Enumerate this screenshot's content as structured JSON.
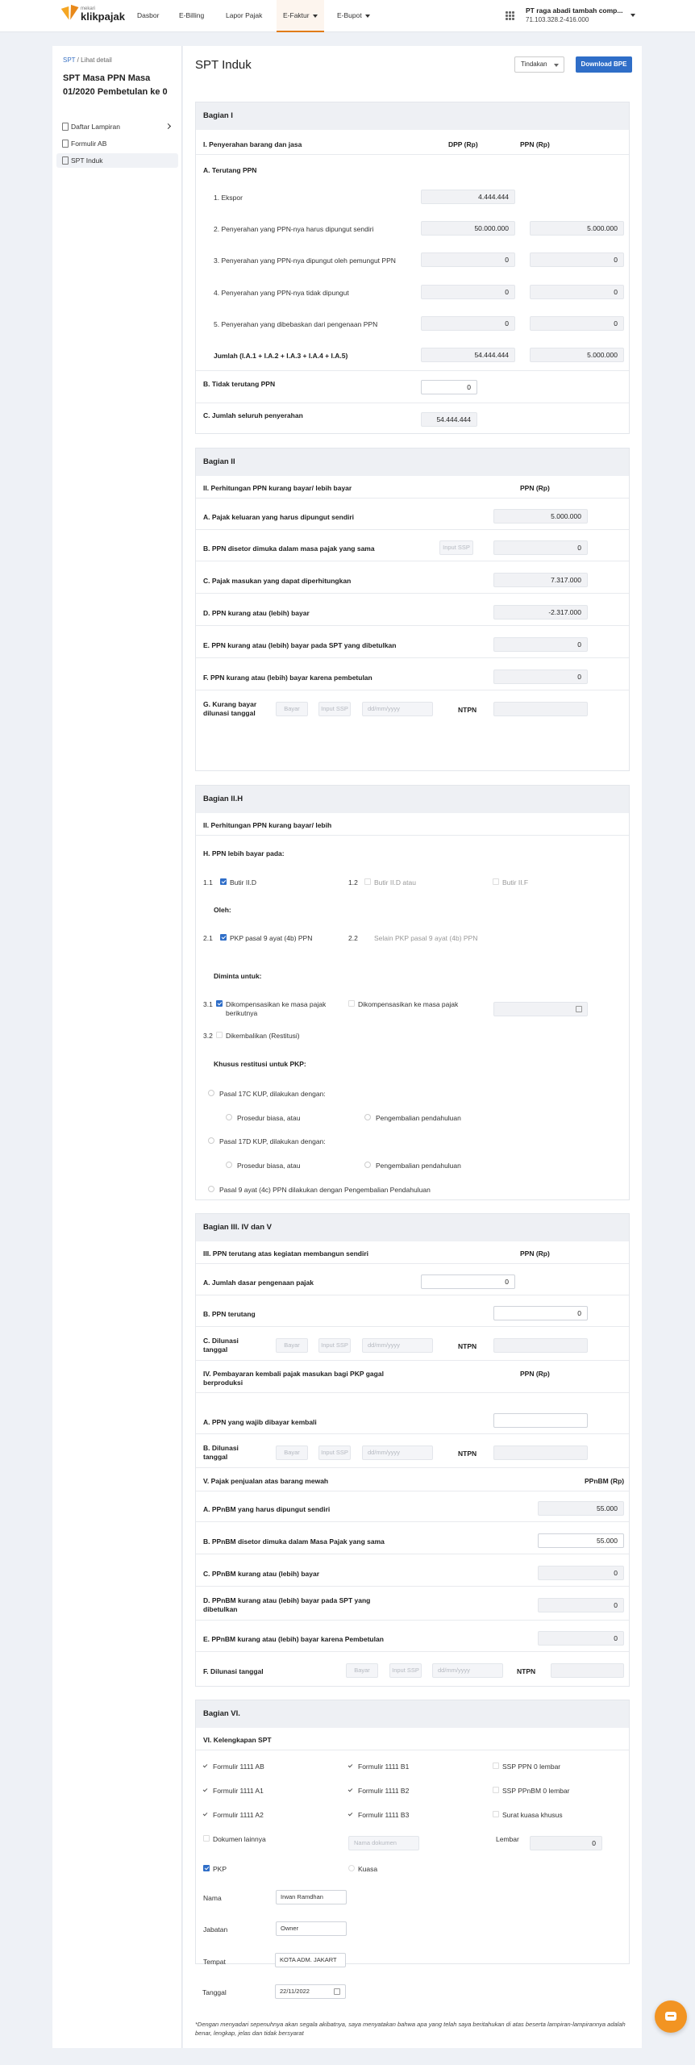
{
  "nav": {
    "logo_small": "mekari",
    "logo_big": "klikpajak",
    "items": [
      "Dasbor",
      "E-Billing",
      "Lapor Pajak",
      "E-Faktur",
      "E-Bupot"
    ],
    "company_name": "PT raga abadi tambah comp...",
    "company_id": "71.103.328.2-416.000"
  },
  "sidebar": {
    "crumb_link": "SPT",
    "crumb_rest": " / Lihat detail",
    "title": "SPT Masa PPN Masa 01/2020 Pembetulan ke 0",
    "items": [
      "Daftar Lampiran",
      "Formulir AB",
      "SPT Induk"
    ]
  },
  "main": {
    "title": "SPT Induk",
    "tindakan": "Tindakan",
    "download": "Download BPE"
  },
  "s1": {
    "header": "Bagian I",
    "col_label": "I. Penyerahan barang dan jasa",
    "col_dpp": "DPP (Rp)",
    "col_ppn": "PPN (Rp)",
    "a_title": "A. Terutang PPN",
    "rows": [
      {
        "label": "1. Ekspor",
        "dpp": "4.444.444",
        "ppn": ""
      },
      {
        "label": "2. Penyerahan yang PPN-nya harus dipungut sendiri",
        "dpp": "50.000.000",
        "ppn": "5.000.000"
      },
      {
        "label": "3. Penyerahan yang PPN-nya dipungut oleh pemungut PPN",
        "dpp": "0",
        "ppn": "0"
      },
      {
        "label": "4. Penyerahan yang PPN-nya tidak dipungut",
        "dpp": "0",
        "ppn": "0"
      },
      {
        "label": "5. Penyerahan yang dibebaskan dari pengenaan PPN",
        "dpp": "0",
        "ppn": "0"
      },
      {
        "label": "Jumlah (I.A.1 + I.A.2 + I.A.3 + I.A.4 + I.A.5)",
        "dpp": "54.444.444",
        "ppn": "5.000.000"
      }
    ],
    "b_label": "B. Tidak terutang PPN",
    "b_value": "0",
    "c_label": "C. Jumlah seluruh penyerahan",
    "c_value": "54.444.444"
  },
  "s2": {
    "header": "Bagian II",
    "col_label": "II. Perhitungan PPN kurang bayar/ lebih bayar",
    "col_ppn": "PPN (Rp)",
    "rows": [
      {
        "label": "A. Pajak keluaran yang harus dipungut sendiri",
        "value": "5.000.000"
      },
      {
        "label": "B. PPN disetor dimuka dalam masa pajak yang sama",
        "value": "0",
        "extra": "Input SSP"
      },
      {
        "label": "C. Pajak masukan yang dapat diperhitungkan",
        "value": "7.317.000"
      },
      {
        "label": "D. PPN kurang atau (lebih) bayar",
        "value": "-2.317.000"
      },
      {
        "label": "E. PPN kurang atau (lebih) bayar pada SPT yang dibetulkan",
        "value": "0"
      },
      {
        "label": "F. PPN kurang atau (lebih) bayar karena pembetulan",
        "value": "0"
      }
    ],
    "g_label": "G. Kurang bayar dilunasi tanggal",
    "bayar": "Bayar",
    "input_ssp": "Input SSP",
    "date_ph": "dd/mm/yyyy",
    "ntpn": "NTPN"
  },
  "s2h": {
    "header": "Bagian II.H",
    "sub": "II. Perhitungan PPN kurang bayar/ lebih",
    "h_title": "H. PPN lebih bayar pada:",
    "n11": "1.1",
    "butir_d": "Butir II.D",
    "n12": "1.2",
    "butir_d_atau": "Butir II.D atau",
    "butir_f": "Butir II.F",
    "oleh": "Oleh:",
    "n21": "2.1",
    "pkp": "PKP pasal 9 ayat (4b) PPN",
    "n22": "2.2",
    "selain": "Selain PKP pasal 9 ayat (4b) PPN",
    "diminta": "Diminta untuk:",
    "n31": "3.1",
    "komp_berikut": "Dikompensasikan ke masa pajak berikutnya",
    "komp_ke": "Dikompensasikan ke masa pajak",
    "n32": "3.2",
    "restitusi": "Dikembalikan (Restitusi)",
    "khusus": "Khusus restitusi untuk PKP:",
    "p17c": "Pasal 17C KUP, dilakukan dengan:",
    "prosedur1": "Prosedur biasa, atau",
    "pengembalian1": "Pengembalian pendahuluan",
    "p17d": "Pasal 17D KUP, dilakukan dengan:",
    "prosedur2": "Prosedur biasa, atau",
    "pengembalian2": "Pengembalian pendahuluan",
    "p9": "Pasal 9 ayat (4c) PPN dilakukan dengan Pengembalian Pendahuluan"
  },
  "s3": {
    "header": "Bagian III. IV dan V",
    "iii_title": "III. PPN terutang atas kegiatan membangun sendiri",
    "col_ppn": "PPN (Rp)",
    "a_label": "A. Jumlah dasar pengenaan pajak",
    "a_value": "0",
    "b_label": "B. PPN terutang",
    "b_value": "0",
    "c_label": "C. Dilunasi tanggal",
    "iv_title": "IV. Pembayaran kembali pajak masukan bagi PKP gagal berproduksi",
    "iv_col": "PPN (Rp)",
    "iva_label": "A. PPN yang wajib dibayar kembali",
    "iva_value": "",
    "ivb_label": "B. Dilunasi tanggal",
    "v_title": "V. Pajak penjualan atas barang mewah",
    "v_col": "PPnBM (Rp)",
    "v_rows": [
      {
        "label": "A. PPnBM yang harus dipungut sendiri",
        "value": "55.000"
      },
      {
        "label": "B. PPnBM disetor dimuka dalam Masa Pajak yang sama",
        "value": "55.000"
      },
      {
        "label": "C. PPnBM kurang atau (lebih) bayar",
        "value": "0"
      },
      {
        "label": "D. PPnBM kurang atau (lebih) bayar pada SPT yang dibetulkan",
        "value": "0"
      },
      {
        "label": "E. PPnBM kurang atau (lebih) bayar karena Pembetulan",
        "value": "0"
      }
    ],
    "f_label": "F. Dilunasi tanggal",
    "bayar": "Bayar",
    "input_ssp": "Input SSP",
    "date_ph": "dd/mm/yyyy",
    "ntpn": "NTPN"
  },
  "s6": {
    "header": "Bagian VI.",
    "sub": "VI. Kelengkapan SPT",
    "c1": [
      "Formulir 1111 AB",
      "Formulir 1111 A1",
      "Formulir 1111 A2"
    ],
    "c2": [
      "Formulir 1111 B1",
      "Formulir 1111 B2",
      "Formulir 1111 B3"
    ],
    "c3": [
      "SSP PPN 0 lembar",
      "SSP PPnBM 0 lembar",
      "Surat kuasa khusus"
    ],
    "dokumen": "Dokumen lainnya",
    "nama_dok_ph": "Nama dokumen",
    "lembar": "Lembar",
    "lembar_val": "0",
    "pkp": "PKP",
    "kuasa": "Kuasa",
    "nama_label": "Nama",
    "nama_val": "Irwan Ramdhan",
    "jabatan_label": "Jabatan",
    "jabatan_val": "Owner",
    "tempat_label": "Tempat",
    "tempat_val": "KOTA ADM. JAKART",
    "tanggal_label": "Tanggal",
    "tanggal_val": "22/11/2022"
  },
  "note": "*Dengan menyadari sepenuhnya akan segala akibatnya, saya menyatakan bahwa apa yang telah saya beritahukan di atas beserta lampiran-lampirannya adalah benar, lengkap, jelas dan tidak bersyarat"
}
